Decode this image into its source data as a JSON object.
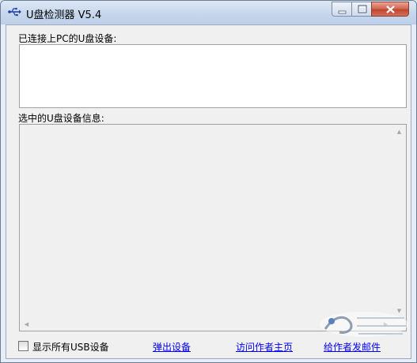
{
  "window": {
    "title": "U盘检测器 V5.4",
    "icon": "usb-icon"
  },
  "connected": {
    "label": "已连接上PC的U盘设备:",
    "items": []
  },
  "info": {
    "label": "选中的U盘设备信息:",
    "content": ""
  },
  "footer": {
    "show_all_label": "显示所有USB设备",
    "show_all_checked": false,
    "eject_label": "弹出设备",
    "visit_label": "访问作者主页",
    "email_label": "给作者发邮件"
  },
  "colors": {
    "link": "#0000ff",
    "close_button": "#c0432d"
  }
}
